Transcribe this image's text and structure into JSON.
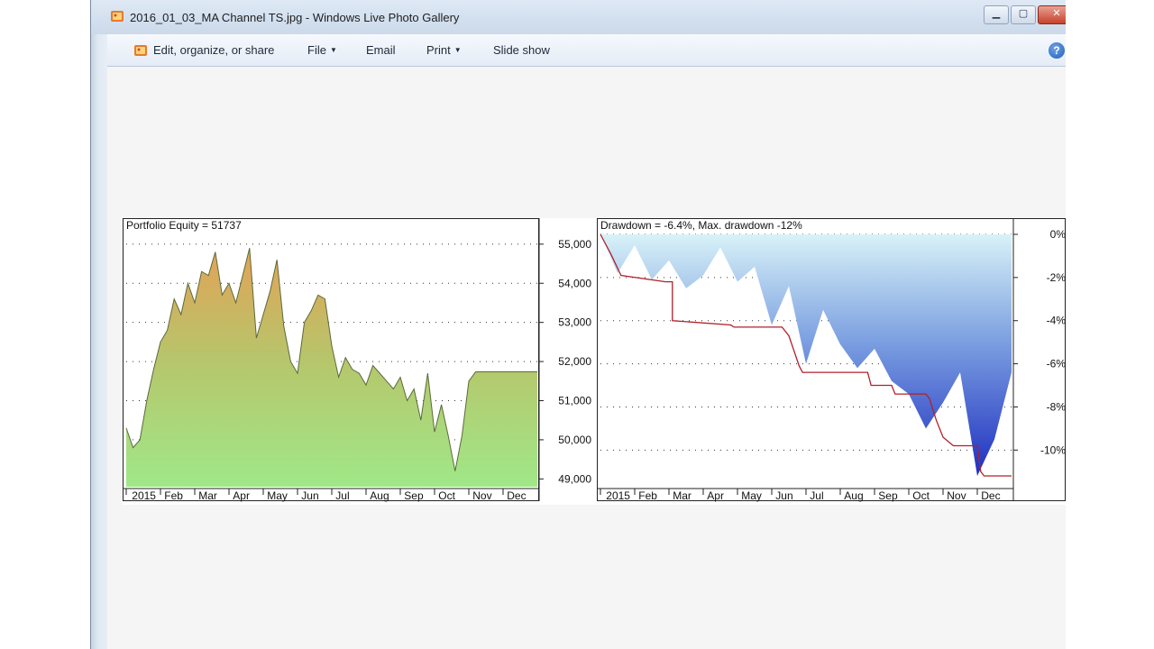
{
  "window": {
    "title": "2016_01_03_MA Channel TS.jpg - Windows Live Photo Gallery"
  },
  "toolbar": {
    "edit_label": "Edit, organize, or share",
    "file_label": "File",
    "email_label": "Email",
    "print_label": "Print",
    "slideshow_label": "Slide show"
  },
  "chart_data": [
    {
      "type": "area",
      "title": "Portfolio Equity = 51737",
      "x_ticks": [
        "2015",
        "Feb",
        "Mar",
        "Apr",
        "May",
        "Jun",
        "Jul",
        "Aug",
        "Sep",
        "Oct",
        "Nov",
        "Dec"
      ],
      "y_ticks": [
        "55,000",
        "54,000",
        "53,000",
        "52,000",
        "51,000",
        "50,000",
        "49,000"
      ],
      "ylim": [
        48800,
        55250
      ],
      "grid": true,
      "series": [
        {
          "x": [
            0,
            0.2,
            0.4,
            0.6,
            0.8,
            1,
            1.2,
            1.4,
            1.6,
            1.8,
            2,
            2.2,
            2.4,
            2.6,
            2.8,
            3,
            3.2,
            3.4,
            3.6,
            3.8,
            4,
            4.2,
            4.4,
            4.6,
            4.8,
            5,
            5.2,
            5.4,
            5.6,
            5.8,
            6,
            6.2,
            6.4,
            6.6,
            6.8,
            7,
            7.2,
            7.4,
            7.6,
            7.8,
            8,
            8.2,
            8.4,
            8.6,
            8.8,
            9,
            9.2,
            9.4,
            9.6,
            9.8,
            10,
            10.2,
            10.4,
            10.6,
            10.8,
            11,
            11.2,
            11.4,
            11.6,
            11.8,
            12
          ],
          "values": [
            50300,
            49800,
            50000,
            51000,
            51800,
            52500,
            52800,
            53600,
            53200,
            54000,
            53500,
            54300,
            54200,
            54800,
            53700,
            54000,
            53500,
            54200,
            54900,
            52600,
            53200,
            53800,
            54600,
            52900,
            52000,
            51700,
            53000,
            53300,
            53700,
            53600,
            52400,
            51600,
            52100,
            51800,
            51700,
            51400,
            51900,
            51700,
            51500,
            51300,
            51600,
            51000,
            51300,
            50500,
            51700,
            50200,
            50900,
            50100,
            49200,
            50100,
            51500,
            51737,
            51737,
            51737,
            51737,
            51737,
            51737,
            51737,
            51737,
            51737,
            51737
          ]
        }
      ]
    },
    {
      "type": "area",
      "title": "Drawdown = -6.4%, Max. drawdown -12%",
      "x_ticks": [
        "2015",
        "Feb",
        "Mar",
        "Apr",
        "May",
        "Jun",
        "Jul",
        "Aug",
        "Sep",
        "Oct",
        "Nov",
        "Dec"
      ],
      "y_ticks": [
        "0%",
        "-2%",
        "-4%",
        "-6%",
        "-8%",
        "-10%"
      ],
      "ylim": [
        -11.7,
        0
      ],
      "grid": true,
      "series": [
        {
          "name": "Drawdown",
          "x": [
            0,
            0.5,
            1,
            1.5,
            2,
            2.5,
            3,
            3.5,
            4,
            4.5,
            5,
            5.5,
            6,
            6.5,
            7,
            7.5,
            8,
            8.5,
            9,
            9.5,
            10,
            10.5,
            11,
            11.5,
            12
          ],
          "values": [
            0,
            -1.8,
            -0.5,
            -2.1,
            -1.2,
            -2.5,
            -1.9,
            -0.6,
            -2.2,
            -1.5,
            -4.2,
            -2.4,
            -6,
            -3.5,
            -5.1,
            -6.2,
            -5.3,
            -6.8,
            -7.4,
            -9,
            -7.8,
            -6.4,
            -11.2,
            -9.5,
            -6.4
          ]
        },
        {
          "name": "Max. drawdown",
          "x": [
            0,
            0.3,
            0.6,
            1.9,
            2.1,
            2.1,
            3.8,
            3.9,
            5.3,
            5.5,
            5.8,
            5.9,
            7.8,
            7.9,
            8.5,
            8.6,
            9.5,
            9.6,
            9.8,
            10,
            10.3,
            10.6,
            11,
            11.1,
            11.2,
            12
          ],
          "values": [
            0,
            -0.9,
            -1.9,
            -2.2,
            -2.2,
            -4,
            -4.2,
            -4.3,
            -4.3,
            -4.7,
            -6.1,
            -6.4,
            -6.4,
            -7,
            -7,
            -7.4,
            -7.4,
            -7.6,
            -8.6,
            -9.4,
            -9.8,
            -9.8,
            -9.8,
            -11,
            -11.2,
            -11.2
          ]
        }
      ]
    }
  ]
}
